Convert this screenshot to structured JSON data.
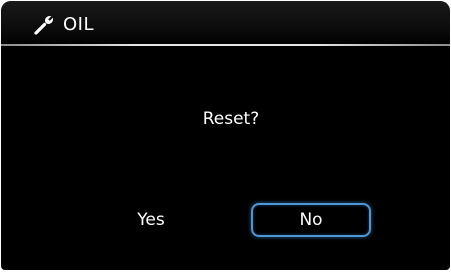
{
  "header": {
    "icon": "wrench-icon",
    "title": "OIL"
  },
  "dialog": {
    "prompt": "Reset?",
    "yes_label": "Yes",
    "no_label": "No",
    "selected": "No",
    "accent_color": "#4b97d8"
  }
}
